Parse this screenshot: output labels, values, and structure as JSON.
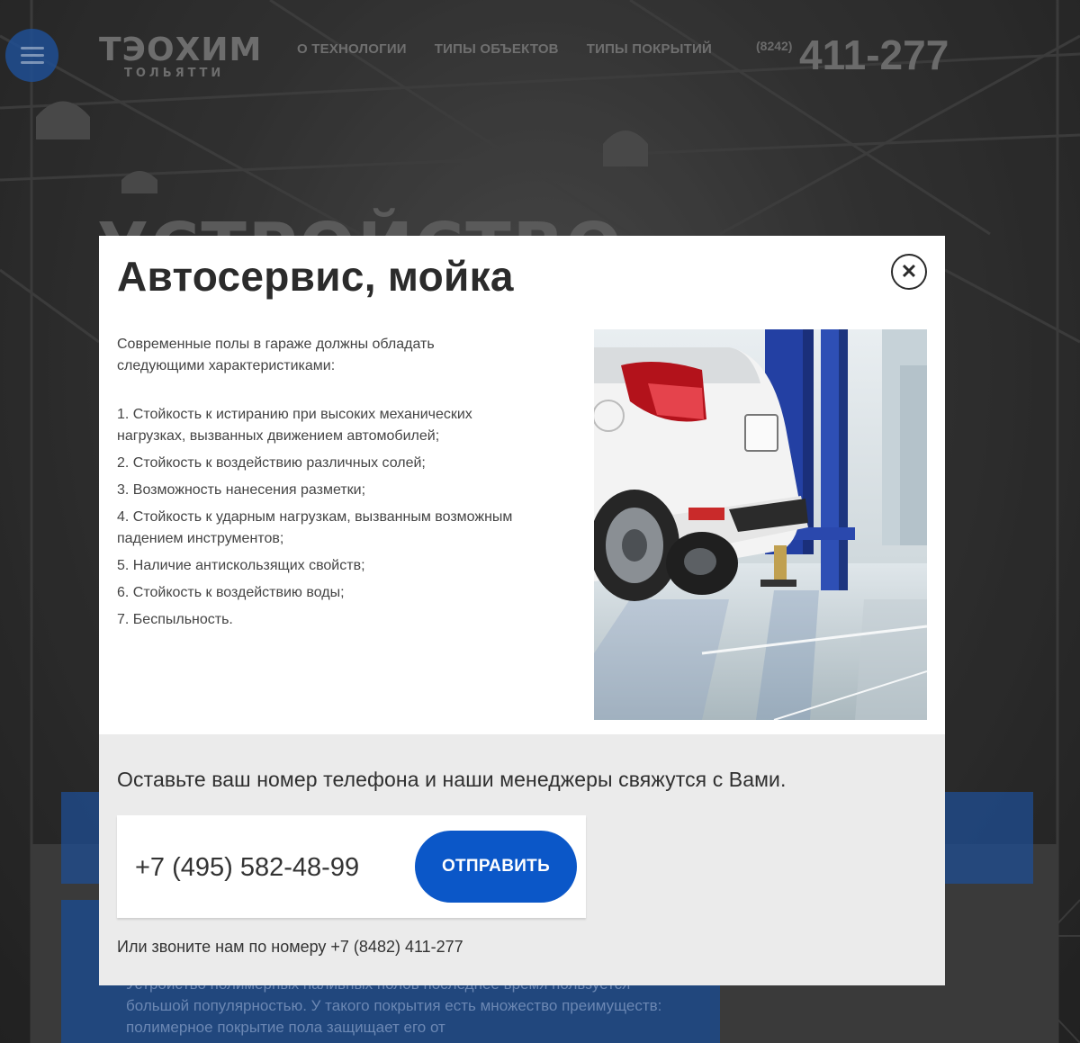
{
  "header": {
    "logo_main": "ТЭОХИМ",
    "logo_city": "ТОЛЬЯТТИ",
    "nav": [
      {
        "label": "О ТЕХНОЛОГИИ"
      },
      {
        "label": "ТИПЫ ОБЪЕКТОВ"
      },
      {
        "label": "ТИПЫ ПОКРЫТИЙ"
      }
    ],
    "phone_code": "(8242)",
    "phone_number": "411-277"
  },
  "hero": {
    "title": "УСТРОЙСТВО"
  },
  "background_text": "Устройство полимерных наливных полов последнее время пользуется большой популярностью. У такого покрытия есть множество преимуществ: полимерное покрытие пола защищает его от",
  "modal": {
    "title": "Автосервис, мойка",
    "close_icon": "close-icon",
    "intro": "Современные полы в гараже должны обладать следующими характеристиками:",
    "items": [
      "1. Стойкость к истиранию при высоких механических нагрузках, вызванных движением автомобилей;",
      "2. Стойкость к воздействию различных солей;",
      "3. Возможность нанесения разметки;",
      "4. Стойкость к ударным нагрузкам, вызванным возможным падением инструментов;",
      "5. Наличие антискользящих свойств;",
      "6. Стойкость к воздействию воды;",
      "7. Беспыльность."
    ],
    "callback_text": "Оставьте ваш номер телефона и наши менеджеры свяжутся с Вами.",
    "phone_value": "+7 (495) 582-48-99",
    "send_label": "ОТПРАВИТЬ",
    "call_text": "Или звоните нам по номеру +7 (8482) 411-277"
  },
  "colors": {
    "accent_blue": "#0b57c8",
    "menu_blue": "#1f4e93",
    "modal_bottom_bg": "#ebebeb"
  }
}
